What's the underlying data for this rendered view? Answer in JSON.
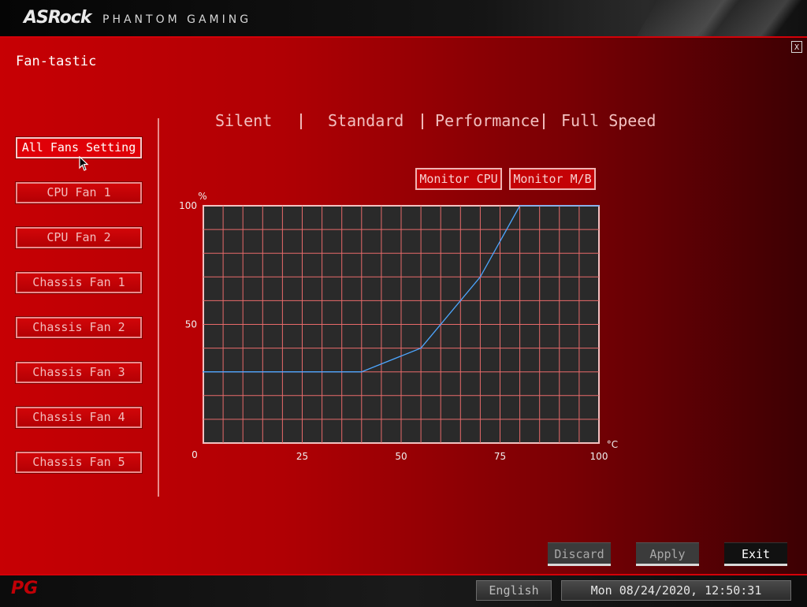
{
  "header": {
    "brand": "ASRock",
    "brand_sub": "PHANTOM GAMING"
  },
  "page_title": "Fan-tastic",
  "close_label": "X",
  "fans": [
    {
      "label": "All Fans Setting",
      "active": true
    },
    {
      "label": "CPU Fan 1",
      "active": false
    },
    {
      "label": "CPU Fan 2",
      "active": false
    },
    {
      "label": "Chassis Fan 1",
      "active": false
    },
    {
      "label": "Chassis Fan 2",
      "active": false
    },
    {
      "label": "Chassis Fan 3",
      "active": false
    },
    {
      "label": "Chassis Fan 4",
      "active": false
    },
    {
      "label": "Chassis Fan 5",
      "active": false
    }
  ],
  "modes": [
    "Silent",
    "Standard",
    "Performance",
    "Full Speed"
  ],
  "monitor": {
    "cpu": "Monitor CPU",
    "mb": "Monitor M/B"
  },
  "chart_data": {
    "type": "line",
    "x_unit": "°C",
    "y_unit": "%",
    "x_ticks": [
      "0",
      "25",
      "50",
      "75",
      "100"
    ],
    "y_ticks": [
      "100",
      "50"
    ],
    "xlim": [
      0,
      100
    ],
    "ylim": [
      0,
      100
    ],
    "grid": true,
    "series": [
      {
        "x": [
          0,
          40,
          55,
          70,
          80,
          100
        ],
        "y": [
          30,
          30,
          40,
          70,
          100,
          100
        ],
        "color": "#4da6ff"
      }
    ]
  },
  "actions": {
    "discard": "Discard",
    "apply": "Apply",
    "exit": "Exit"
  },
  "footer": {
    "logo": "PG",
    "language": "English",
    "datetime": "Mon 08/24/2020, 12:50:31"
  },
  "colors": {
    "accent": "#d40008",
    "grid_line": "#e86a6a",
    "curve": "#4da6ff"
  }
}
